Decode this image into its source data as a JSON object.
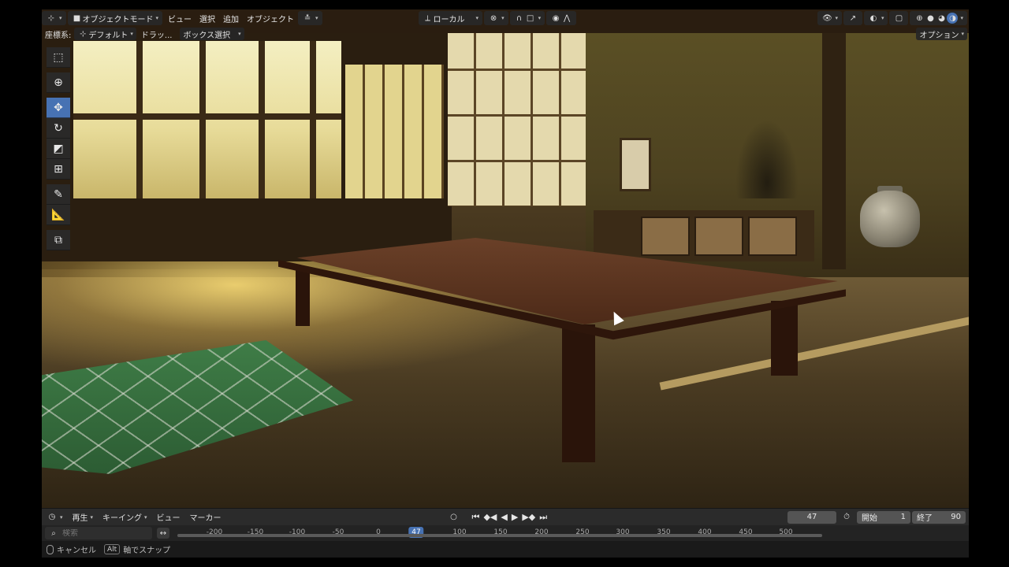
{
  "header": {
    "mode_label": "オブジェクトモード",
    "menus": [
      "ビュー",
      "選択",
      "追加",
      "オブジェクト"
    ],
    "transform_orientation": "ローカル",
    "options_label": "オプション"
  },
  "subheader": {
    "coord_label": "座標系:",
    "coord_value": "デフォルト",
    "drag_label": "ドラッ...",
    "select_mode": "ボックス選択"
  },
  "toolbar": {
    "tools": [
      "select-box-icon",
      "cursor-icon",
      "move-icon",
      "rotate-icon",
      "scale-icon",
      "transform-icon",
      "annotate-icon",
      "measure-icon",
      "add-cube-icon"
    ]
  },
  "timeline": {
    "menus": [
      "再生",
      "キーイング",
      "ビュー",
      "マーカー"
    ],
    "current_frame": "47",
    "start_label": "開始",
    "start_value": "1",
    "end_label": "終了",
    "end_value": "90",
    "search_placeholder": "検索",
    "ticks": [
      "-200",
      "-150",
      "-100",
      "-50",
      "0",
      "100",
      "150",
      "200",
      "250",
      "300",
      "350",
      "400",
      "450",
      "500"
    ],
    "playhead_label": "47"
  },
  "statusbar": {
    "cancel_label": "キャンセル",
    "alt_key": "Alt",
    "snap_label": "軸でスナップ"
  }
}
